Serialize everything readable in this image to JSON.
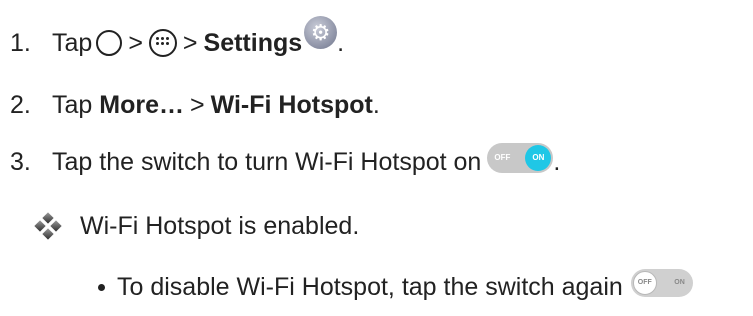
{
  "steps": [
    {
      "num": "1.",
      "text": "Tap",
      "sep1": ">",
      "sep2": ">",
      "bold": "Settings",
      "end": "."
    },
    {
      "num": "2.",
      "text": "Tap",
      "bold1": "More…",
      "sep": ">",
      "bold2": "Wi-Fi Hotspot",
      "end": "."
    },
    {
      "num": "3.",
      "text": "Tap the switch to turn Wi-Fi Hotspot on",
      "end": "."
    }
  ],
  "result": "Wi-Fi Hotspot is enabled.",
  "bullet": "To disable Wi-Fi Hotspot, tap the switch again",
  "toggle_on": {
    "off_label": "OFF",
    "on_label": "ON",
    "accent": "#1fc7e6"
  },
  "toggle_off": {
    "off_label": "OFF",
    "on_label": "ON"
  },
  "icons": [
    "home-icon",
    "apps-icon",
    "settings-icon",
    "diamond-icon"
  ]
}
